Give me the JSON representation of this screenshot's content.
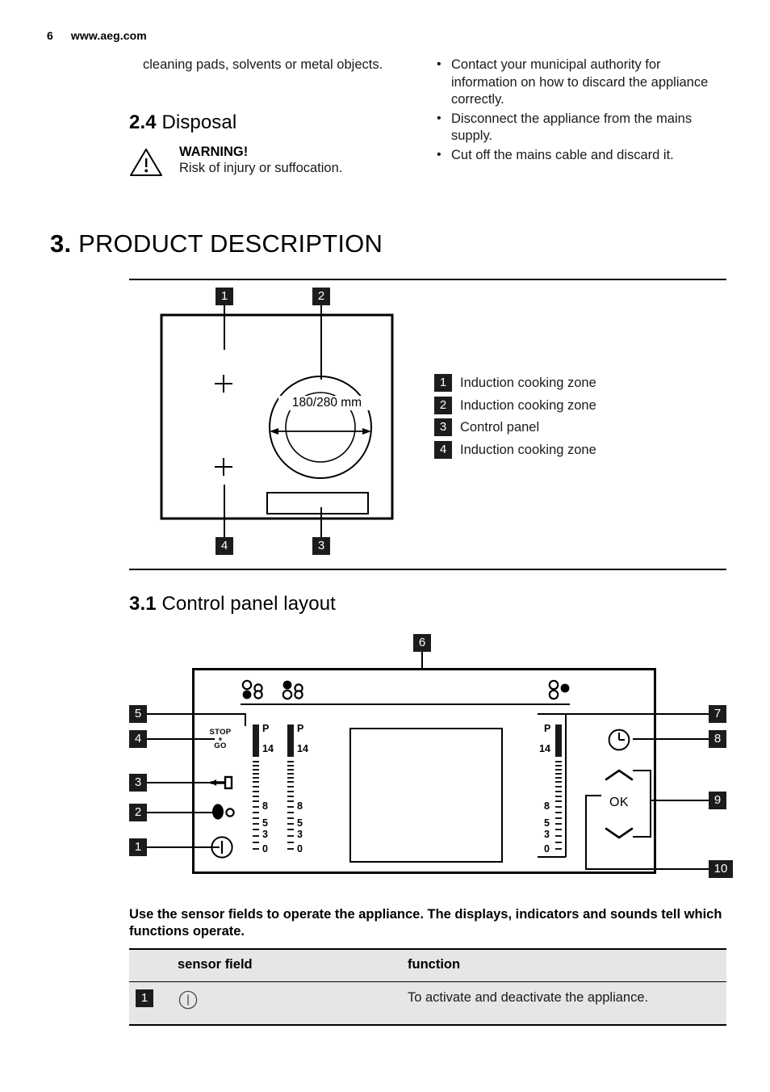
{
  "runhead": {
    "page": "6",
    "site": "www.aeg.com"
  },
  "intro": {
    "left_continuation": "cleaning pads, solvents or metal objects.",
    "bullets": [
      "Contact your municipal authority for information on how to discard the appliance correctly.",
      "Disconnect the appliance from the mains supply.",
      "Cut off the mains cable and discard it."
    ]
  },
  "disposal": {
    "number": "2.4",
    "title": "Disposal",
    "warning_title": "WARNING!",
    "warning_text": "Risk of injury or suffocation."
  },
  "chapter": {
    "number": "3.",
    "title": "PRODUCT DESCRIPTION"
  },
  "hob": {
    "dimension_label": "180/280 mm",
    "callouts": [
      "1",
      "2",
      "4",
      "3"
    ],
    "legend": [
      {
        "num": "1",
        "label": "Induction cooking zone"
      },
      {
        "num": "2",
        "label": "Induction cooking zone"
      },
      {
        "num": "3",
        "label": "Control panel"
      },
      {
        "num": "4",
        "label": "Induction cooking zone"
      }
    ]
  },
  "control_panel": {
    "number": "3.1",
    "title": "Control panel layout",
    "callouts": [
      "1",
      "2",
      "3",
      "4",
      "5",
      "6",
      "7",
      "8",
      "9",
      "10"
    ],
    "icons": {
      "stop_go_line1": "STOP",
      "stop_go_plus": "+",
      "stop_go_line2": "GO",
      "ok_label": "OK"
    },
    "slider_labels": [
      "P",
      "14",
      "8",
      "5",
      "3",
      "0"
    ]
  },
  "sensor_table": {
    "intro": "Use the sensor fields to operate the appliance. The displays, indicators and sounds tell which functions operate.",
    "headers": {
      "num": "",
      "sensor_field": "sensor field",
      "function": "function"
    },
    "rows": [
      {
        "num": "1",
        "sensor_field_icon": "power-icon",
        "function": "To activate and deactivate the appliance."
      }
    ]
  },
  "colors": {
    "ink": "#000000",
    "callout_bg": "#1c1c1c",
    "table_bg": "#e6e6e6"
  }
}
